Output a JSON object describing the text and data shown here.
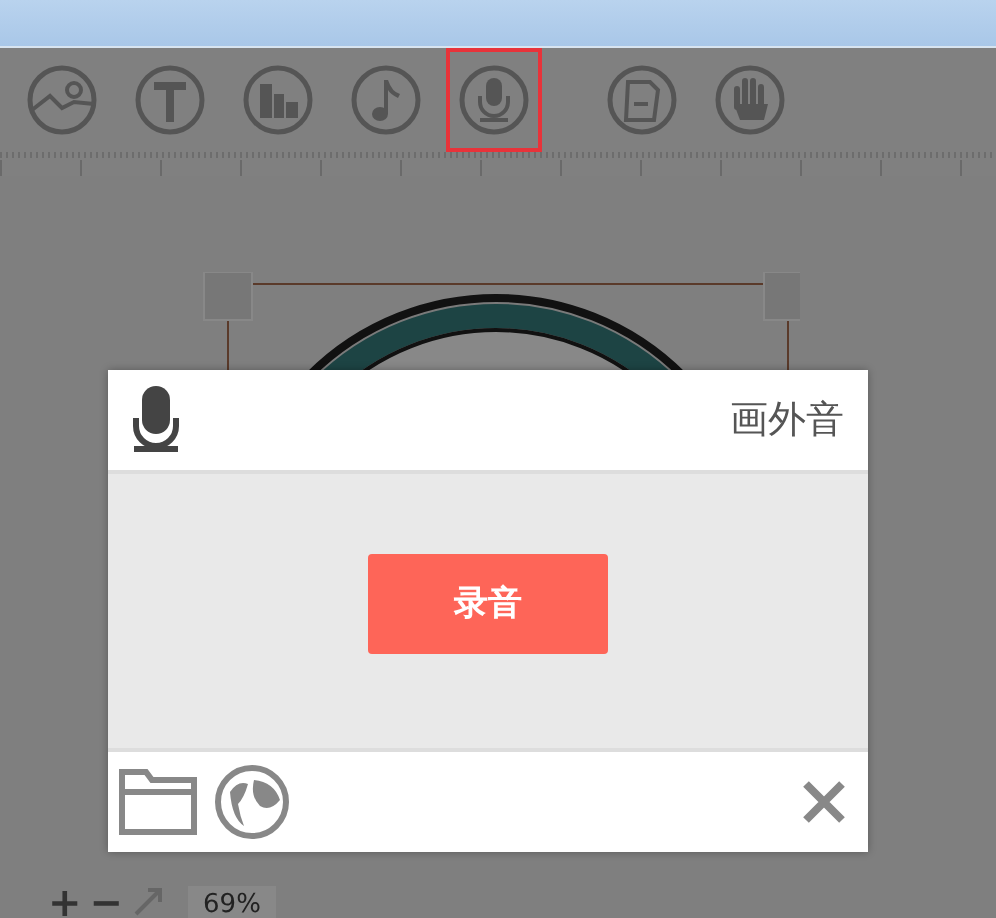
{
  "toolbar": {
    "tools": [
      {
        "kind": "picture",
        "selected": false
      },
      {
        "kind": "text",
        "selected": false
      },
      {
        "kind": "chart",
        "selected": false
      },
      {
        "kind": "music",
        "selected": false
      },
      {
        "kind": "microphone",
        "selected": true
      },
      {
        "kind": "document",
        "selected": false
      },
      {
        "kind": "hand",
        "selected": false
      }
    ]
  },
  "dialog": {
    "title": "画外音",
    "record_button": "录音"
  },
  "zoom_bar": {
    "zoom_in": "+",
    "zoom_out": "−",
    "level": "69%"
  }
}
